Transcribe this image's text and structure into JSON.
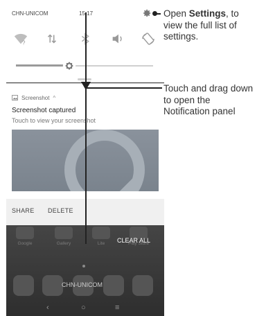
{
  "status_bar": {
    "carrier": "CHN-UNICOM",
    "time": "15:17"
  },
  "quick_tiles": [
    "wifi-off-icon",
    "data-arrows-icon",
    "bluetooth-icon",
    "volume-icon",
    "auto-rotate-icon"
  ],
  "brightness": {
    "level": 0.39
  },
  "notification": {
    "app": "Screenshot",
    "title": "Screenshot captured",
    "text": "Touch to view your screenshot"
  },
  "actions": {
    "share": "SHARE",
    "delete": "DELETE"
  },
  "home": {
    "apps": [
      {
        "label": "Google"
      },
      {
        "label": "Gallery"
      },
      {
        "label": "Lite"
      },
      {
        "label": "Play Store"
      }
    ],
    "clear_all": "CLEAR ALL",
    "dock_carrier": "CHN-UNICOM"
  },
  "nav": {
    "back": "‹",
    "home": "○",
    "recents": "≡"
  },
  "callouts": {
    "settings": {
      "pre": "Open ",
      "bold": "Settings",
      "post": ", to view the full list of settings."
    },
    "drag": {
      "text": "Touch and drag down to open the Notification panel"
    }
  },
  "colors": {
    "frame": "#3a3a3a",
    "accent_gray": "#9a9a9a"
  }
}
